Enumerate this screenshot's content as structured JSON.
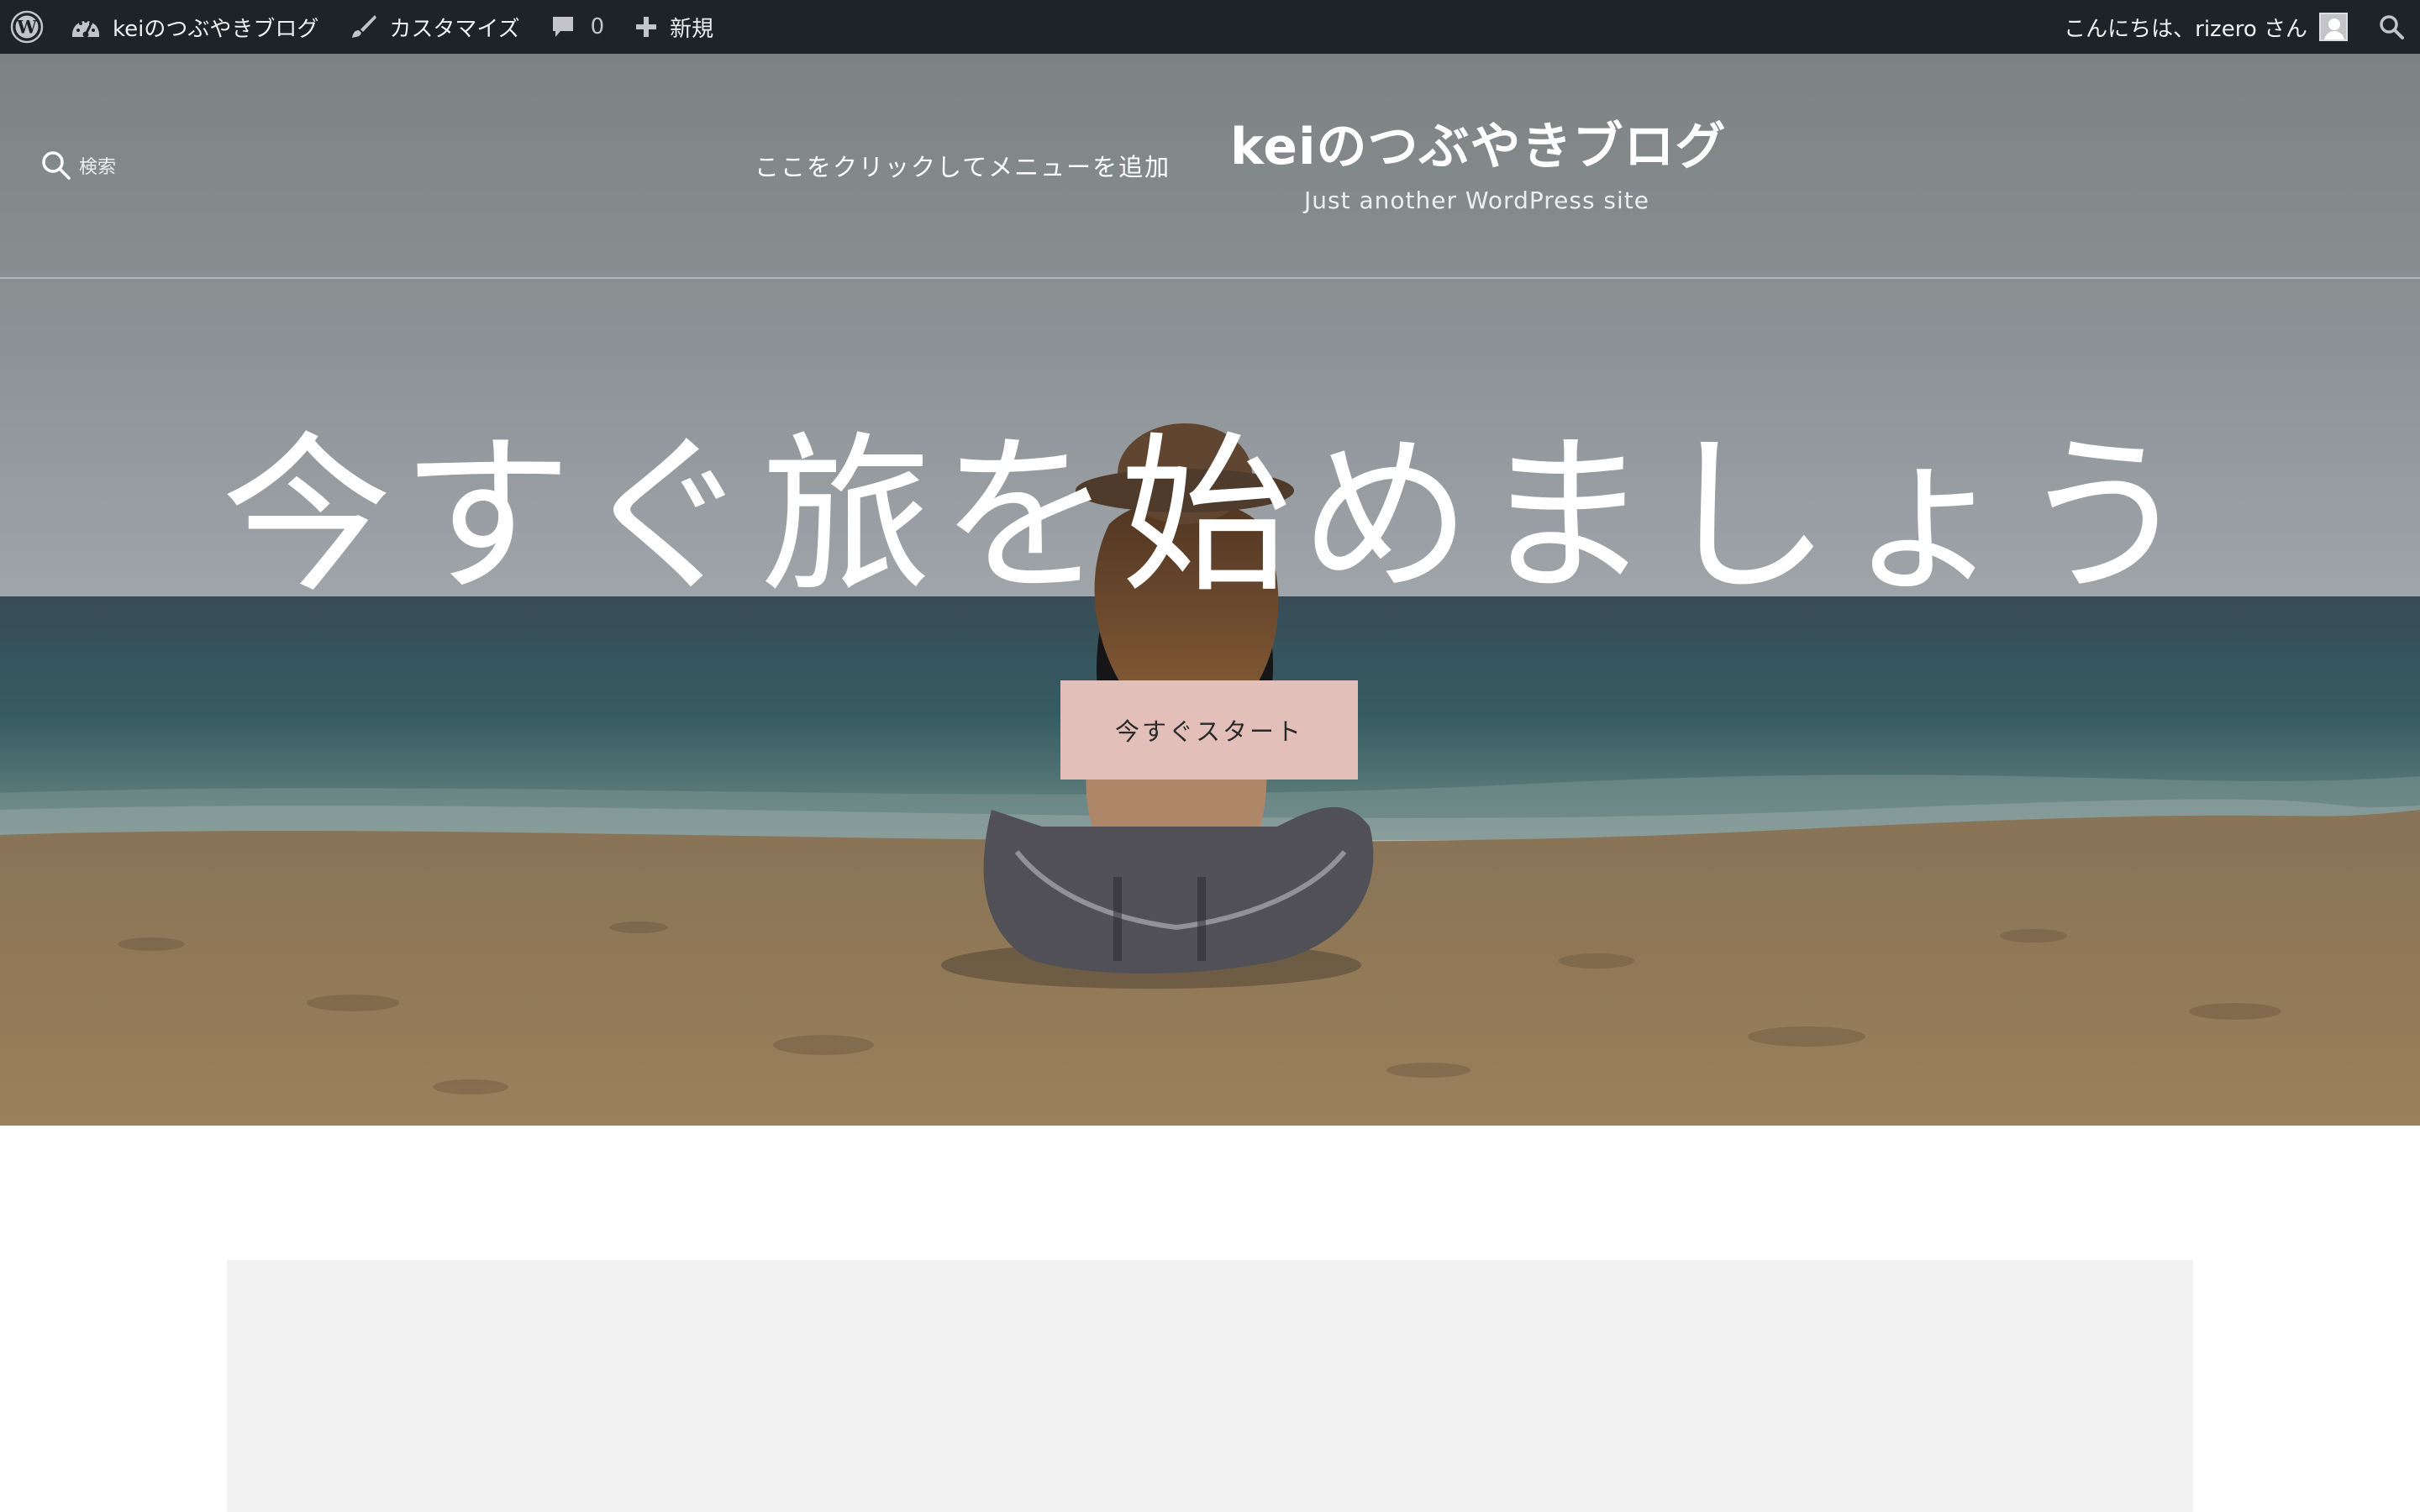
{
  "adminbar": {
    "site_name": "keiのつぶやきブログ",
    "customize": "カスタマイズ",
    "comments_count": "0",
    "new_label": "新規",
    "greeting": "こんにちは、rizero さん",
    "icons": {
      "wp": "wordpress-logo-icon",
      "dashboard": "dashboard-gauge-icon",
      "customize": "paintbrush-icon",
      "comments": "comment-bubble-icon",
      "new": "plus-icon",
      "avatar": "user-avatar",
      "search": "search-icon"
    },
    "colors": {
      "background": "#1d2327",
      "text": "#f0f0f1"
    }
  },
  "header": {
    "search_label": "検索",
    "menu_prompt": "ここをクリックしてメニューを追加",
    "site_title": "keiのつぶやきブログ",
    "site_description": "Just another WordPress site"
  },
  "hero": {
    "heading": "今すぐ旅を始めましょう",
    "button_label": "今すぐスタート",
    "colors": {
      "button": "#e2bfb8"
    }
  }
}
